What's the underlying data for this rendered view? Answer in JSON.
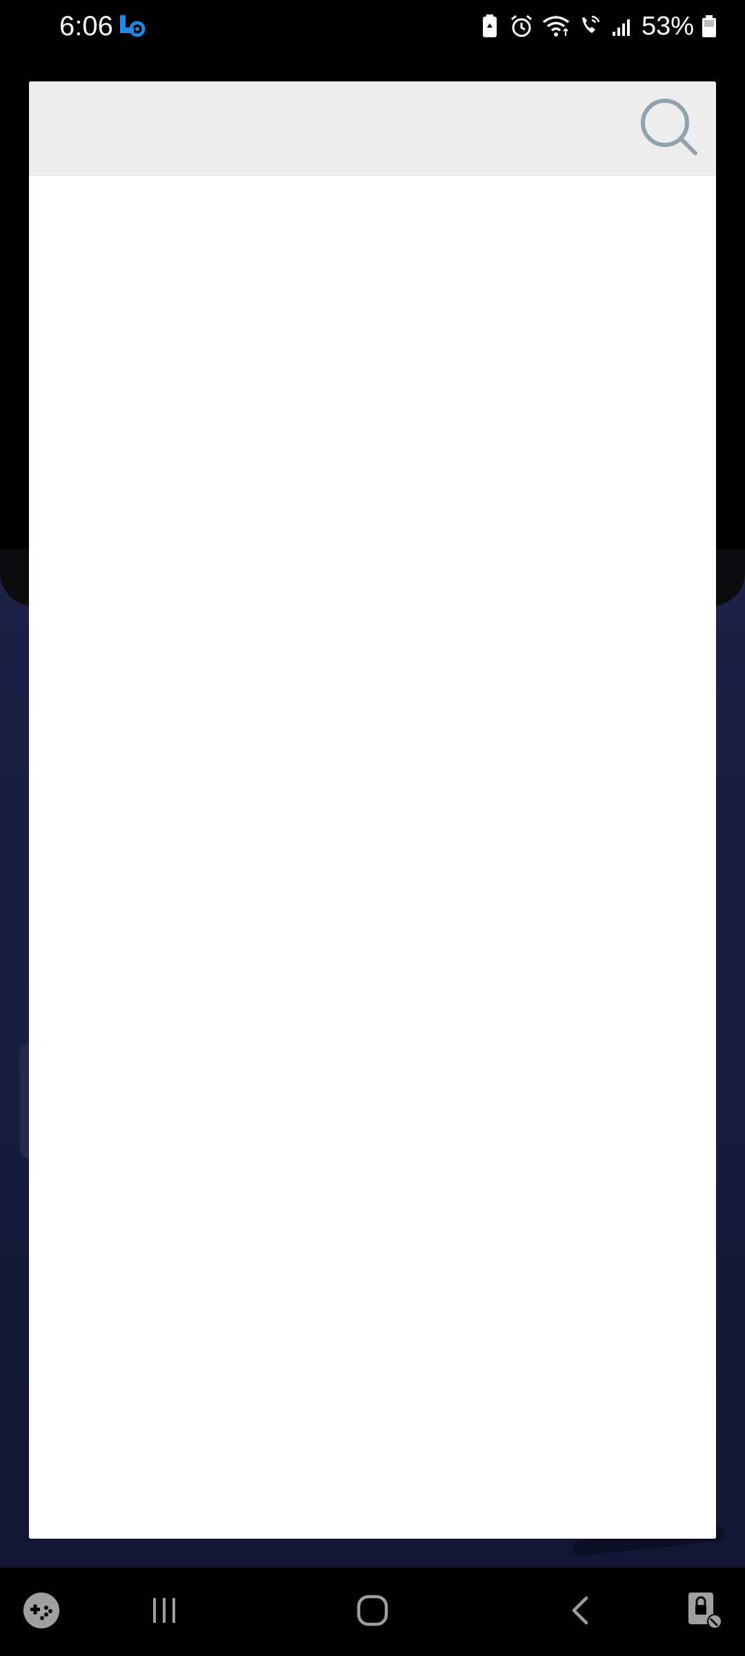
{
  "status_bar": {
    "time": "6:06",
    "battery_percent": "53%",
    "icons": [
      "settings-gear-notification-icon",
      "battery-saver-icon",
      "alarm-icon",
      "wifi-icon",
      "wifi-calling-icon",
      "signal-icon",
      "battery-icon"
    ]
  },
  "dialog": {
    "header": {
      "search_icon": "search-icon"
    }
  },
  "nav_bar": {
    "buttons": [
      "game-launcher",
      "recent-apps",
      "home",
      "back",
      "secure-folder"
    ]
  },
  "colors": {
    "background_app": "#1d2246",
    "dialog_header": "#ededed",
    "search_icon": "#8fa3ae",
    "status_accent": "#1e88e5"
  }
}
